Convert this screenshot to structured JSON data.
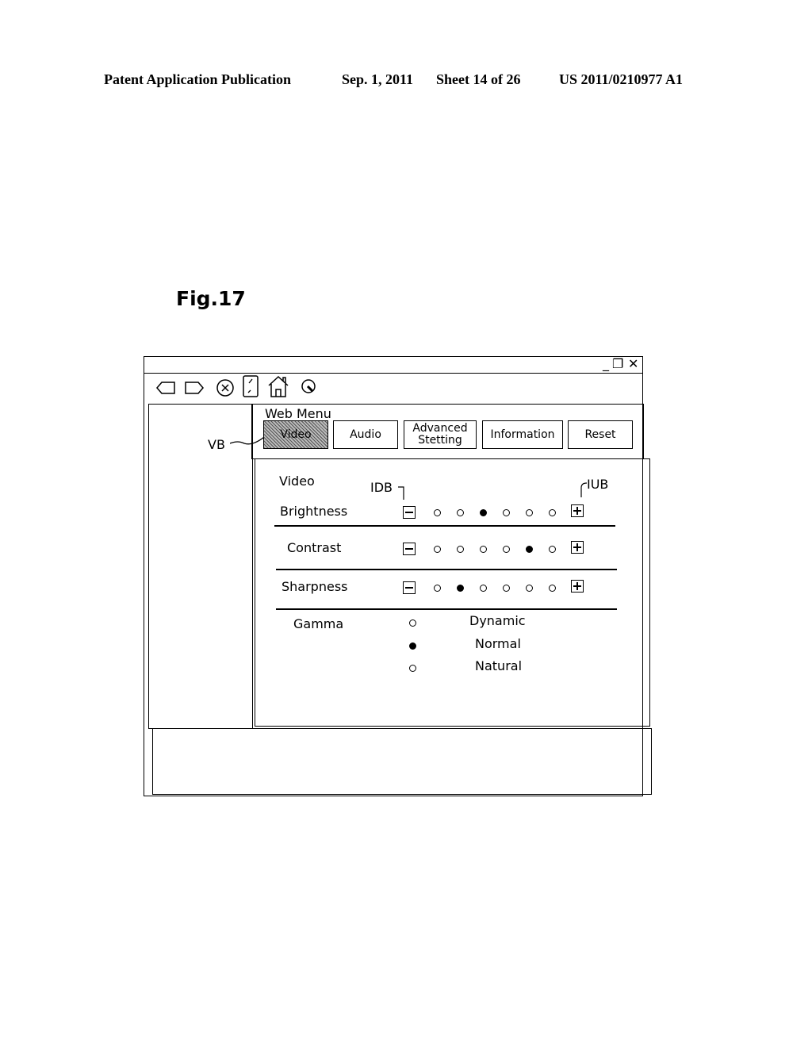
{
  "header": {
    "publication": "Patent Application Publication",
    "date": "Sep. 1, 2011",
    "sheet": "Sheet 14 of 26",
    "number": "US 2011/0210977 A1"
  },
  "figure_label": "Fig.17",
  "window": {
    "controls": {
      "minimize": "_",
      "restore": "❐",
      "close": "✕"
    },
    "toolbar_icons": [
      "back-arrow-icon",
      "forward-arrow-icon",
      "stop-icon",
      "reload-icon",
      "home-icon",
      "search-icon"
    ]
  },
  "menu": {
    "title": "Web Menu",
    "buttons": [
      {
        "label": "Video",
        "active": true
      },
      {
        "label": "Audio",
        "active": false
      },
      {
        "label": "Advanced Stetting",
        "active": false
      },
      {
        "label": "Information",
        "active": false
      },
      {
        "label": "Reset",
        "active": false
      }
    ]
  },
  "callouts": {
    "vb": "VB",
    "idb": "IDB",
    "iub": "IUB"
  },
  "settings": {
    "section_title": "Video",
    "sliders": [
      {
        "label": "Brightness",
        "steps": 6,
        "selected": 3
      },
      {
        "label": "Contrast",
        "steps": 6,
        "selected": 5
      },
      {
        "label": "Sharpness",
        "steps": 6,
        "selected": 2
      }
    ],
    "gamma": {
      "label": "Gamma",
      "options": [
        {
          "label": "Dynamic",
          "selected": false
        },
        {
          "label": "Normal",
          "selected": true
        },
        {
          "label": "Natural",
          "selected": false
        }
      ]
    }
  }
}
